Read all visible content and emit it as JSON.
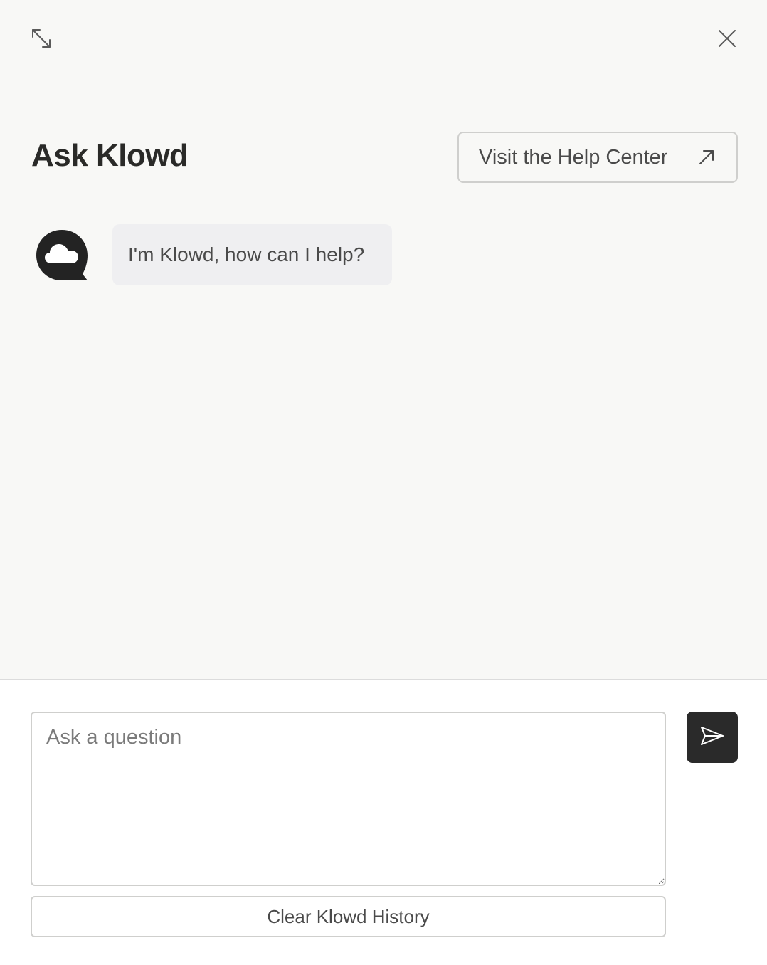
{
  "header": {
    "expand_icon": "expand-diagonal-icon",
    "close_icon": "close-icon"
  },
  "title": "Ask Klowd",
  "help_center": {
    "label": "Visit the Help Center",
    "icon": "external-arrow-icon"
  },
  "chat": {
    "avatar_icon": "klowd-cloud-logo-icon",
    "messages": [
      {
        "role": "assistant",
        "text": "I'm Klowd, how can I help?"
      }
    ]
  },
  "composer": {
    "placeholder": "Ask a question",
    "value": "",
    "send_icon": "paper-plane-send-icon"
  },
  "clear_button": {
    "label": "Clear Klowd History"
  },
  "colors": {
    "panel_background": "#f8f8f6",
    "bubble_background": "#efeff1",
    "send_button_background": "#2a2a2a",
    "border": "#cfcfcd"
  }
}
